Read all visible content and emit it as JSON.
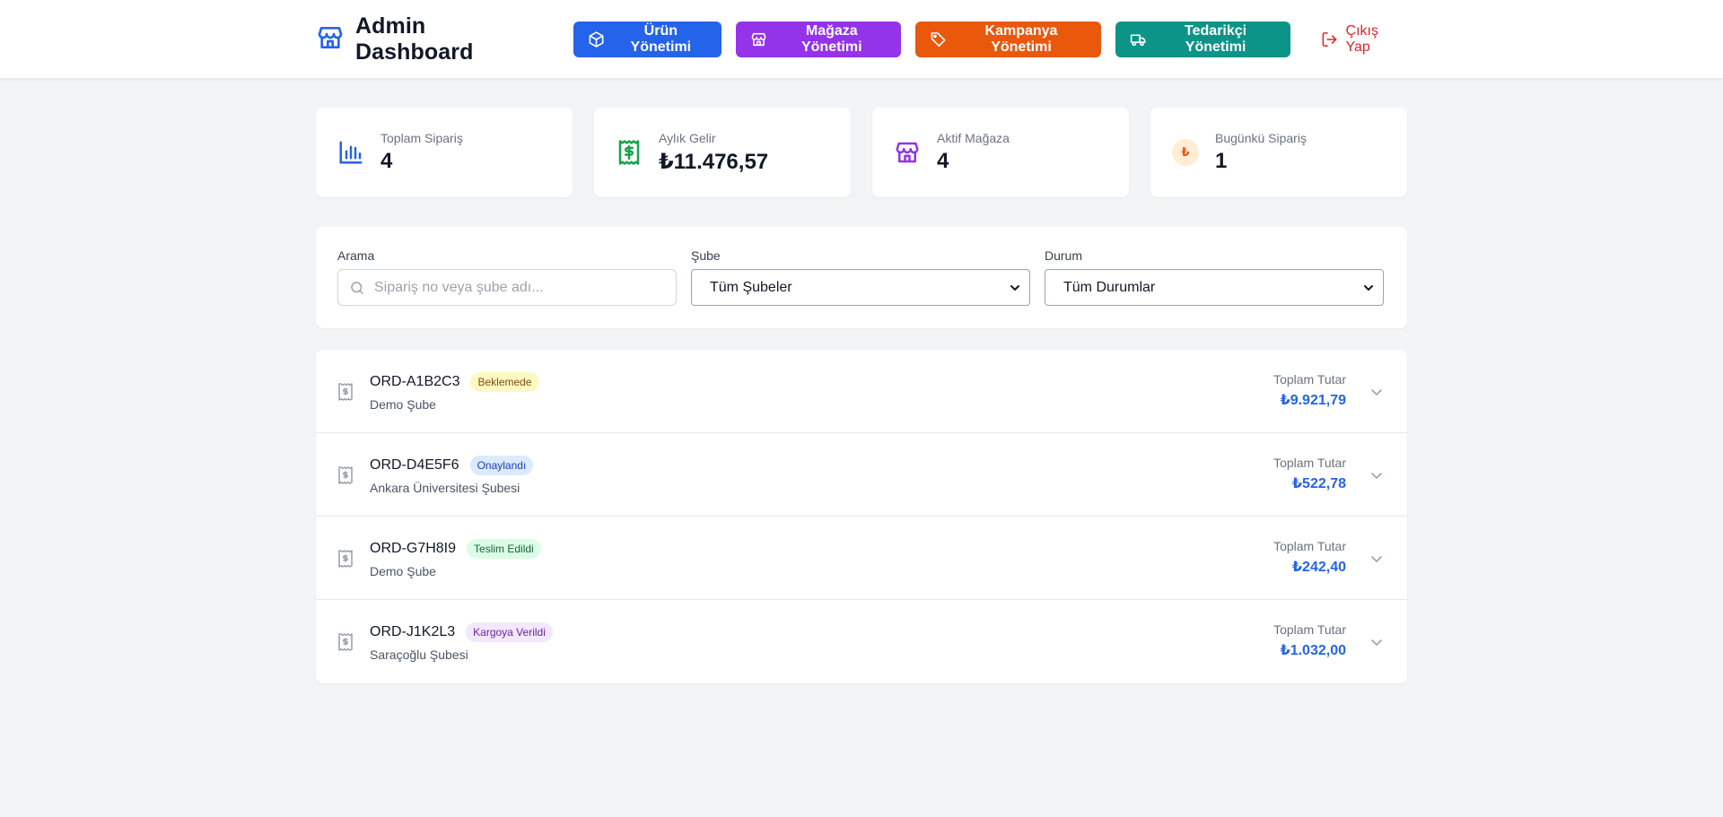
{
  "header": {
    "title": "Admin Dashboard",
    "logo_icon": "store-icon",
    "nav": [
      {
        "label": "Ürün Yönetimi",
        "icon": "box-icon",
        "color": "#2563eb"
      },
      {
        "label": "Mağaza Yönetimi",
        "icon": "store-icon",
        "color": "#9333ea"
      },
      {
        "label": "Kampanya Yönetimi",
        "icon": "tag-icon",
        "color": "#ea580c"
      },
      {
        "label": "Tedarikçi Yönetimi",
        "icon": "truck-icon",
        "color": "#0d9488"
      }
    ],
    "logout_label": "Çıkış Yap"
  },
  "stats": [
    {
      "label": "Toplam Sipariş",
      "value": "4",
      "icon": "bar-chart-icon",
      "color": "#2563eb"
    },
    {
      "label": "Aylık Gelir",
      "value": "₺11.476,57",
      "icon": "receipt-dollar-icon",
      "color": "#16a34a"
    },
    {
      "label": "Aktif Mağaza",
      "value": "4",
      "icon": "store-icon",
      "color": "#9333ea"
    },
    {
      "label": "Bugünkü Sipariş",
      "value": "1",
      "icon": "lira-icon",
      "icon_glyph": "₺",
      "color": "#ea580c"
    }
  ],
  "filters": {
    "search": {
      "label": "Arama",
      "placeholder": "Sipariş no veya şube adı..."
    },
    "branch": {
      "label": "Şube",
      "selected": "Tüm Şubeler"
    },
    "status": {
      "label": "Durum",
      "selected": "Tüm Durumlar"
    }
  },
  "orders": [
    {
      "id": "ORD-A1B2C3",
      "status": "Beklemede",
      "branch": "Demo Şube",
      "total_label": "Toplam Tutar",
      "total": "₺9.921,79"
    },
    {
      "id": "ORD-D4E5F6",
      "status": "Onaylandı",
      "branch": "Ankara Üniversitesi Şubesi",
      "total_label": "Toplam Tutar",
      "total": "₺522,78"
    },
    {
      "id": "ORD-G7H8I9",
      "status": "Teslim Edildi",
      "branch": "Demo Şube",
      "total_label": "Toplam Tutar",
      "total": "₺242,40"
    },
    {
      "id": "ORD-J1K2L3",
      "status": "Kargoya Verildi",
      "branch": "Saraçoğlu Şubesi",
      "total_label": "Toplam Tutar",
      "total": "₺1.032,00"
    }
  ]
}
